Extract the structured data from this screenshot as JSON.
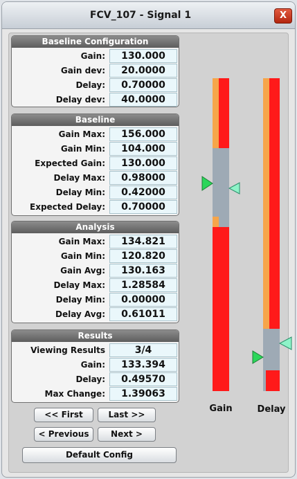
{
  "window": {
    "title": "FCV_107 - Signal 1",
    "close_label": "X"
  },
  "baseline_config": {
    "header": "Baseline Configuration",
    "rows": [
      {
        "label": "Gain:",
        "value": "130.000"
      },
      {
        "label": "Gain dev:",
        "value": "20.0000"
      },
      {
        "label": "Delay:",
        "value": "0.70000"
      },
      {
        "label": "Delay dev:",
        "value": "40.0000"
      }
    ]
  },
  "baseline": {
    "header": "Baseline",
    "rows": [
      {
        "label": "Gain Max:",
        "value": "156.000"
      },
      {
        "label": "Gain Min:",
        "value": "104.000"
      },
      {
        "label": "Expected Gain:",
        "value": "130.000"
      },
      {
        "label": "Delay Max:",
        "value": "0.98000"
      },
      {
        "label": "Delay Min:",
        "value": "0.42000"
      },
      {
        "label": "Expected Delay:",
        "value": "0.70000"
      }
    ]
  },
  "analysis": {
    "header": "Analysis",
    "rows": [
      {
        "label": "Gain Max:",
        "value": "134.821"
      },
      {
        "label": "Gain Min:",
        "value": "120.820"
      },
      {
        "label": "Gain Avg:",
        "value": "130.163"
      },
      {
        "label": "Delay Max:",
        "value": "1.28584"
      },
      {
        "label": "Delay Min:",
        "value": "0.00000"
      },
      {
        "label": "Delay Avg:",
        "value": "0.61011"
      }
    ]
  },
  "results": {
    "header": "Results",
    "rows": [
      {
        "label": "Viewing Results",
        "value": "3/4"
      },
      {
        "label": "Gain:",
        "value": "133.394"
      },
      {
        "label": "Delay:",
        "value": "0.49570"
      },
      {
        "label": "Max Change:",
        "value": "1.39063"
      }
    ]
  },
  "buttons": {
    "first": "<< First",
    "last": "Last >>",
    "previous": "< Previous",
    "next": "Next >",
    "default_config": "Default Config"
  },
  "meters": {
    "gain_label": "Gain",
    "delay_label": "Delay",
    "colors": {
      "bar": "#ff1a1a",
      "band": "#f6a54a",
      "range": "#9eaab5",
      "marker_current": "#2bd65a",
      "marker_expected": "#8ef3c8"
    }
  }
}
